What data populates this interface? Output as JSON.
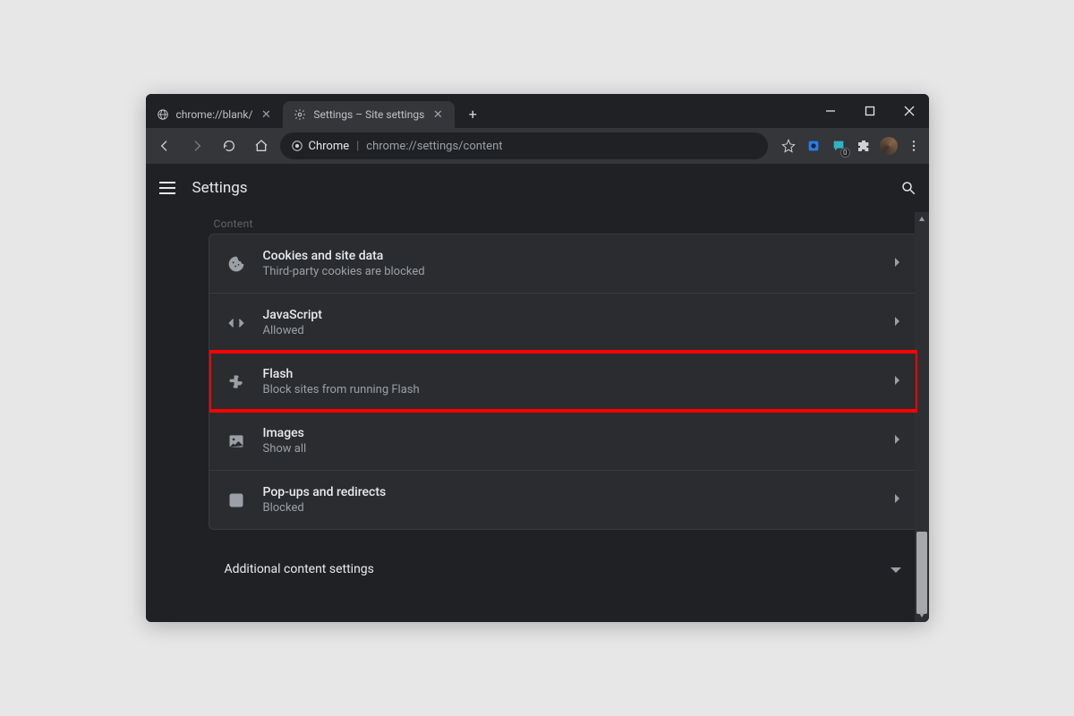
{
  "window": {
    "tabs": [
      {
        "title": "chrome://blank/",
        "active": false
      },
      {
        "title": "Settings – Site settings",
        "active": true
      }
    ]
  },
  "toolbar": {
    "chip_label": "Chrome",
    "url": "chrome://settings/content"
  },
  "appbar": {
    "title": "Settings"
  },
  "content": {
    "section_label": "Content",
    "rows": [
      {
        "icon": "cookie",
        "title": "Cookies and site data",
        "sub": "Third-party cookies are blocked"
      },
      {
        "icon": "code",
        "title": "JavaScript",
        "sub": "Allowed"
      },
      {
        "icon": "puzzle",
        "title": "Flash",
        "sub": "Block sites from running Flash",
        "highlight": true
      },
      {
        "icon": "image",
        "title": "Images",
        "sub": "Show all"
      },
      {
        "icon": "popup",
        "title": "Pop-ups and redirects",
        "sub": "Blocked"
      }
    ],
    "expander": "Additional content settings"
  },
  "icons": {
    "ext_badge": "0"
  }
}
